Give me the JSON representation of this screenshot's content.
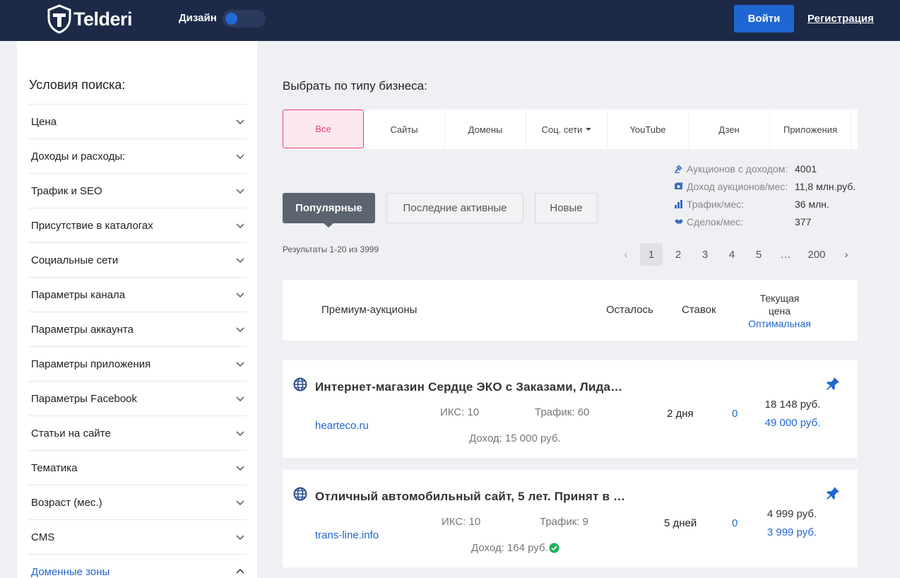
{
  "header": {
    "logo_text": "Telderi",
    "design_label": "Дизайн",
    "login_label": "Войти",
    "register_label": "Регистрация"
  },
  "sidebar": {
    "title": "Условия поиска:",
    "items": [
      {
        "label": "Цена",
        "expanded": false
      },
      {
        "label": "Доходы и расходы:",
        "expanded": false
      },
      {
        "label": "Трафик и SEO",
        "expanded": false
      },
      {
        "label": "Присутствие в каталогах",
        "expanded": false
      },
      {
        "label": "Социальные сети",
        "expanded": false
      },
      {
        "label": "Параметры канала",
        "expanded": false
      },
      {
        "label": "Параметры аккаунта",
        "expanded": false
      },
      {
        "label": "Параметры приложения",
        "expanded": false
      },
      {
        "label": "Параметры Facebook",
        "expanded": false
      },
      {
        "label": "Статьи на сайте",
        "expanded": false
      },
      {
        "label": "Тематика",
        "expanded": false
      },
      {
        "label": "Возраст (мес.)",
        "expanded": false
      },
      {
        "label": "CMS",
        "expanded": false
      },
      {
        "label": "Доменные зоны",
        "expanded": true
      }
    ]
  },
  "main": {
    "title": "Выбрать по типу бизнеса:",
    "types": [
      {
        "label": "Все",
        "active": true
      },
      {
        "label": "Сайты",
        "active": false
      },
      {
        "label": "Домены",
        "active": false
      },
      {
        "label": "Соц. сети",
        "active": false,
        "dropdown": true
      },
      {
        "label": "YouTube",
        "active": false
      },
      {
        "label": "Дзен",
        "active": false
      },
      {
        "label": "Приложения",
        "active": false
      }
    ],
    "stats": [
      {
        "icon": "gavel-icon",
        "label": "Аукционов с доходом:",
        "value": "4001"
      },
      {
        "icon": "money-icon",
        "label": "Доход аукционов/мес:",
        "value": "11,8 млн.руб."
      },
      {
        "icon": "bar-chart-icon",
        "label": "Трафик/мес:",
        "value": "36 млн."
      },
      {
        "icon": "handshake-icon",
        "label": "Сделок/мес:",
        "value": "377"
      }
    ],
    "sort_tabs": [
      {
        "label": "Популярные",
        "active": true
      },
      {
        "label": "Последние активные",
        "active": false
      },
      {
        "label": "Новые",
        "active": false
      }
    ],
    "results_text": "Результаты 1-20 из 3999",
    "pagination": {
      "prev": "‹",
      "pages": [
        "1",
        "2",
        "3",
        "4",
        "5",
        "…",
        "200"
      ],
      "current": "1",
      "next": "›"
    },
    "table_head": {
      "title": "Премиум-аукционы",
      "remaining": "Осталось",
      "bids": "Ставок",
      "price_line1": "Текущая",
      "price_line2": "цена",
      "price_optimal": "Оптимальная"
    },
    "lots": [
      {
        "title": "Интернет-магазин Сердце ЭКО с Заказами, Лида…",
        "domain": "hearteco.ru",
        "iks": "ИКС: 10",
        "traffic": "Трафик: 60",
        "income": "Доход: 15 000 руб.",
        "verified": false,
        "remaining": "2 дня",
        "bids": "0",
        "price": "18 148 руб.",
        "price_optimal": "49 000 руб."
      },
      {
        "title": "Отличный автомобильный сайт, 5 лет. Принят в …",
        "domain": "trans-line.info",
        "iks": "ИКС: 10",
        "traffic": "Трафик: 9",
        "income": "Доход: 164 руб.",
        "verified": true,
        "remaining": "5 дней",
        "bids": "0",
        "price": "4 999 руб.",
        "price_optimal": "3 999 руб."
      }
    ]
  },
  "colors": {
    "header_bg": "#1c2a47",
    "accent_blue": "#1f66d1",
    "active_pink": "#e6407a",
    "verified_green": "#19b35a"
  }
}
